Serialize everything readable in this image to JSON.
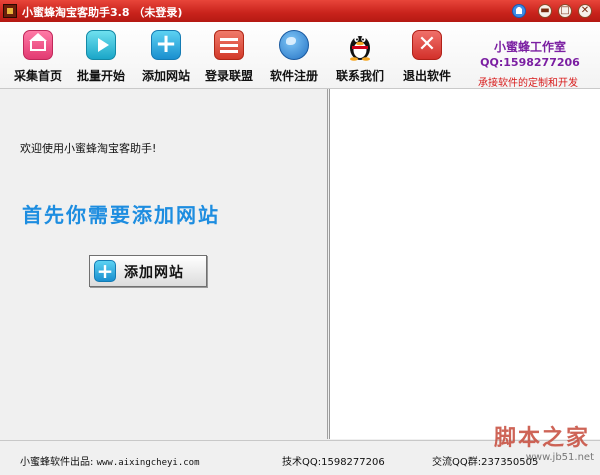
{
  "window": {
    "title": "小蜜蜂淘宝客助手3.8 （未登录)",
    "min_glyph": "▬",
    "max_glyph": "□",
    "close_glyph": "✕"
  },
  "toolbar": {
    "items": [
      {
        "label": "采集首页",
        "icon": "home-icon"
      },
      {
        "label": "批量开始",
        "icon": "play-icon"
      },
      {
        "label": "添加网站",
        "icon": "plus-icon"
      },
      {
        "label": "登录联盟",
        "icon": "brick-icon"
      },
      {
        "label": "软件注册",
        "icon": "globe-icon"
      },
      {
        "label": "联系我们",
        "icon": "qq-penguin-icon"
      },
      {
        "label": "退出软件",
        "icon": "close-x-icon"
      }
    ],
    "add_glyph": "+",
    "exit_glyph": "✕"
  },
  "studio": {
    "name": "小蜜蜂工作室",
    "qq": "QQ:1598277206",
    "slogan": "承接软件的定制和开发"
  },
  "main": {
    "welcome": "欢迎使用小蜜蜂淘宝客助手!",
    "headline": "首先你需要添加网站",
    "add_button": "添加网站",
    "add_glyph": "+"
  },
  "statusbar": {
    "publisher_label": "小蜜蜂软件出品:",
    "publisher_url": "www.aixingcheyi.com",
    "support_qq": "技术QQ:1598277206",
    "group_qq": "交流QQ群:237350505"
  },
  "watermark": {
    "title": "脚本之家",
    "url": "www.jb51.net"
  },
  "colors": {
    "titlebar": "#c8221b",
    "studio_text": "#7b1fa2",
    "slogan_text": "#d81b1b",
    "headline_text": "#1d8de0"
  }
}
